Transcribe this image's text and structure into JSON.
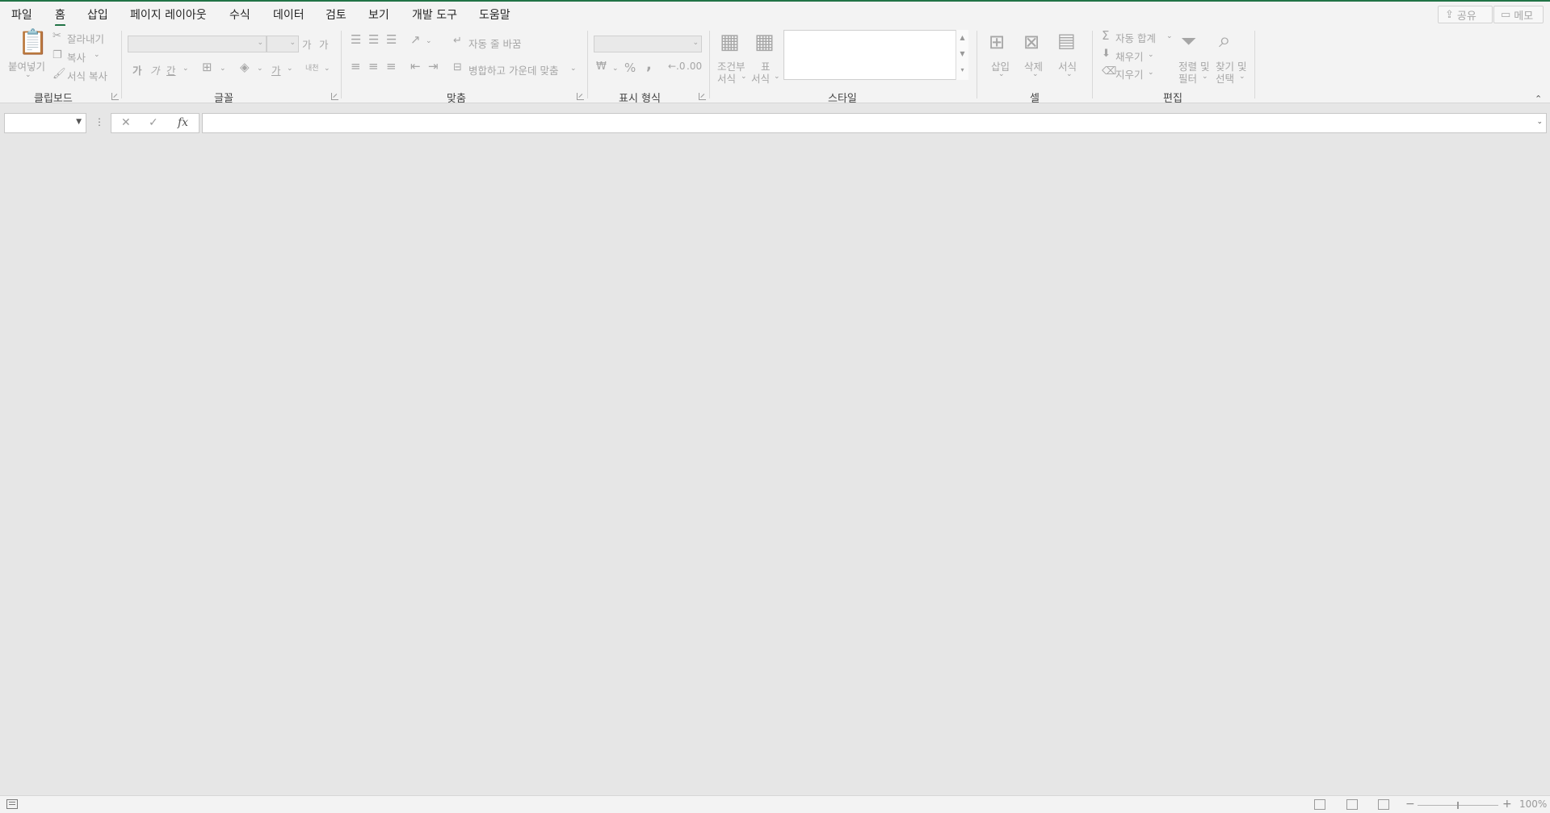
{
  "tabs": [
    {
      "label": "파일",
      "active": false
    },
    {
      "label": "홈",
      "active": true
    },
    {
      "label": "삽입",
      "active": false
    },
    {
      "label": "페이지 레이아웃",
      "active": false
    },
    {
      "label": "수식",
      "active": false
    },
    {
      "label": "데이터",
      "active": false
    },
    {
      "label": "검토",
      "active": false
    },
    {
      "label": "보기",
      "active": false
    },
    {
      "label": "개발 도구",
      "active": false
    },
    {
      "label": "도움말",
      "active": false
    }
  ],
  "top_buttons": {
    "share": "공유",
    "comments": "메모"
  },
  "clipboard": {
    "group": "클립보드",
    "paste": "붙여넣기",
    "cut": "잘라내기",
    "copy": "복사",
    "format_painter": "서식 복사"
  },
  "font": {
    "group": "글꼴",
    "increase": "가",
    "decrease": "가",
    "bold": "가",
    "italic": "가",
    "underline": "간",
    "fill": "가",
    "phonetic": "내천"
  },
  "alignment": {
    "group": "맞춤",
    "wrap_text": "자동 줄 바꿈",
    "merge_center": "병합하고 가운데 맞춤"
  },
  "number": {
    "group": "표시 형식",
    "percent": "%",
    "comma": ","
  },
  "styles": {
    "group": "스타일",
    "conditional_1": "조건부",
    "conditional_2": "서식",
    "table_1": "표",
    "table_2": "서식"
  },
  "cells": {
    "group": "셀",
    "insert": "삽입",
    "delete": "삭제",
    "format": "서식"
  },
  "editing": {
    "group": "편집",
    "autosum": "자동 합계",
    "fill": "채우기",
    "clear": "지우기",
    "sort_1": "정렬 및",
    "sort_2": "필터",
    "find_1": "찾기 및",
    "find_2": "선택"
  },
  "formula_bar": {
    "fx": "fx",
    "namebox_value": "",
    "formula_value": ""
  },
  "status": {
    "zoom": "100%"
  },
  "colors": {
    "accent": "#217346",
    "ribbon_bg": "#f3f3f3",
    "workspace_bg": "#e6e6e6"
  }
}
